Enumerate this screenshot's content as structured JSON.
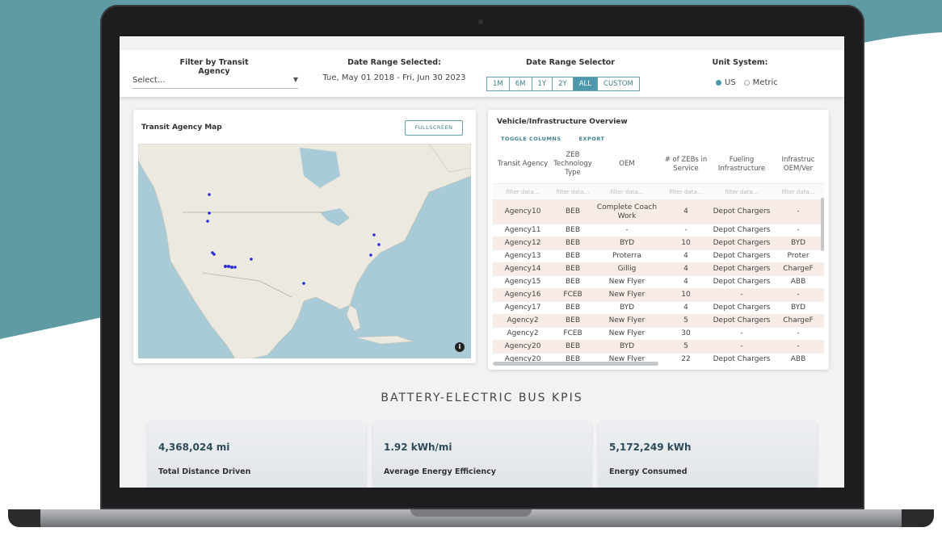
{
  "filter_bar": {
    "agency_label": "Filter by Transit Agency",
    "agency_placeholder": "Select...",
    "date_label": "Date Range Selected:",
    "date_value": "Tue, May 01 2018 - Fri, Jun 30 2023",
    "selector_label": "Date Range Selector",
    "ranges": [
      "1M",
      "6M",
      "1Y",
      "2Y",
      "ALL",
      "CUSTOM"
    ],
    "active_range": "ALL",
    "unit_label": "Unit System:",
    "units": [
      "US",
      "Metric"
    ],
    "selected_unit": "US"
  },
  "map_card": {
    "title": "Transit Agency Map",
    "fullscreen_label": "FULLSCREEN",
    "info_glyph": "i"
  },
  "table_card": {
    "title": "Vehicle/Infrastructure Overview",
    "toggle_label": "TOGGLE COLUMNS",
    "export_label": "EXPORT",
    "columns": [
      "Transit Agency",
      "ZEB Technology Type",
      "OEM",
      "# of ZEBs in Service",
      "Fueling Infrastructure",
      "Infrastruc OEM/Ver"
    ],
    "filter_placeholder": "filter data...",
    "rows": [
      [
        "Agency10",
        "BEB",
        "Complete Coach Work",
        "4",
        "Depot Chargers",
        "-"
      ],
      [
        "Agency11",
        "BEB",
        "-",
        "-",
        "Depot Chargers",
        "-"
      ],
      [
        "Agency12",
        "BEB",
        "BYD",
        "10",
        "Depot Chargers",
        "BYD"
      ],
      [
        "Agency13",
        "BEB",
        "Proterra",
        "4",
        "Depot Chargers",
        "Proter"
      ],
      [
        "Agency14",
        "BEB",
        "Gillig",
        "4",
        "Depot Chargers",
        "ChargeF"
      ],
      [
        "Agency15",
        "BEB",
        "New Flyer",
        "4",
        "Depot Chargers",
        "ABB"
      ],
      [
        "Agency16",
        "FCEB",
        "New Flyer",
        "10",
        "-",
        "-"
      ],
      [
        "Agency17",
        "BEB",
        "BYD",
        "4",
        "Depot Chargers",
        "BYD"
      ],
      [
        "Agency2",
        "BEB",
        "New Flyer",
        "5",
        "Depot Chargers",
        "ChargeF"
      ],
      [
        "Agency2",
        "FCEB",
        "New Flyer",
        "30",
        "-",
        "-"
      ],
      [
        "Agency20",
        "BEB",
        "BYD",
        "5",
        "-",
        "-"
      ],
      [
        "Agency20",
        "BEB",
        "New Flyer",
        "22",
        "Depot Chargers",
        "ABB"
      ]
    ]
  },
  "kpis": {
    "section_title": "BATTERY-ELECTRIC BUS KPIS",
    "items": [
      {
        "value": "4,368,024 mi",
        "label": "Total Distance Driven"
      },
      {
        "value": "1.92 kWh/mi",
        "label": "Average Energy Efficiency"
      },
      {
        "value": "5,172,249 kWh",
        "label": "Energy Consumed"
      }
    ]
  },
  "colors": {
    "accent": "#4d98ad",
    "background_teal": "#5f9ba5",
    "map_water": "#a9cbd7",
    "map_land": "#ece9e1",
    "marker": "#2b2bd6"
  }
}
